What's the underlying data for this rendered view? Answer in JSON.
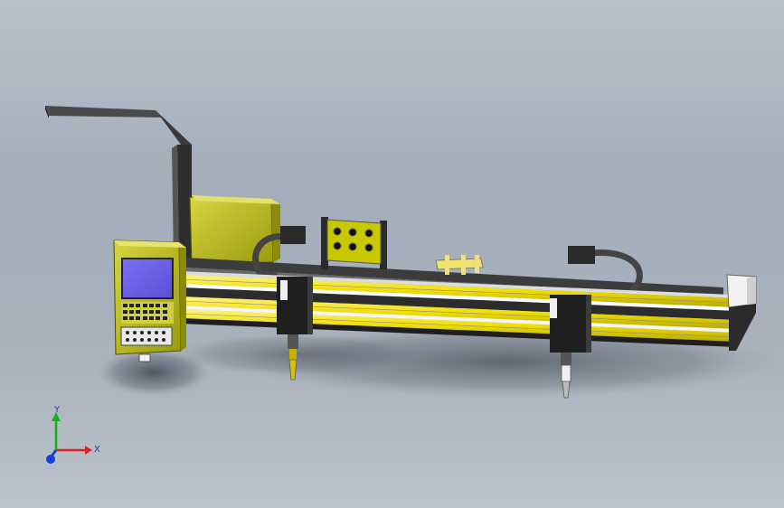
{
  "scene": {
    "kind": "cad-3d-model",
    "subject": "gantry-cutting-machine"
  },
  "triad": {
    "x_label": "X",
    "y_label": "Y",
    "x_color": "#e02020",
    "y_color": "#18b018",
    "z_color": "#1a3fd8"
  },
  "colors": {
    "frame": "#c8c800",
    "rail": "#f4e400",
    "steel": "#3a3a3a",
    "screen": "#6c62e8",
    "background": "#a9b2bd"
  }
}
